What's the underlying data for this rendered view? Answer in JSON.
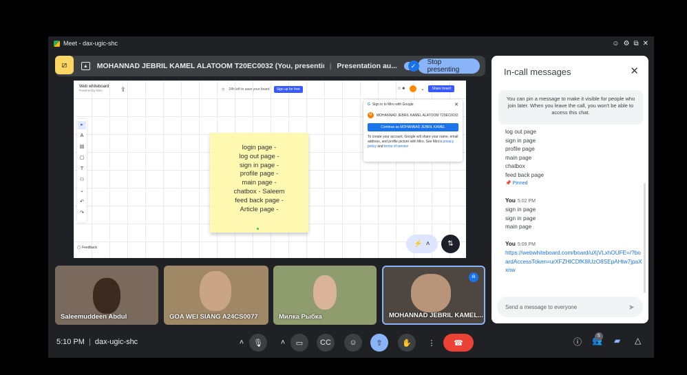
{
  "window": {
    "title": "Meet - dax-ugic-shc",
    "controls": [
      "☺",
      "⚙",
      "⧉",
      "✕"
    ]
  },
  "present_bar": {
    "title": "MOHANNAD JEBRIL KAMEL ALATOOM T20EC0032 (You, presenting, anno...",
    "auto_label": "Presentation au...",
    "stop_label": "Stop presenting"
  },
  "whiteboard": {
    "name": "Web whiteboard",
    "powered_by": "Powered by Miro",
    "save_hint": "24h left to save your board",
    "signup_label": "Sign up for free",
    "share_label": "Share board",
    "feedback_label": "Feedback",
    "tools": [
      "▸",
      "A",
      "▤",
      "▢",
      "T",
      "⚇",
      "⌄",
      "↶",
      "↷"
    ],
    "sticky_lines": [
      "login page -",
      "log out page -",
      "sign in page -",
      "profile page -",
      "main page -",
      "chatbox - Saleem",
      "feed back page -",
      "Article page -"
    ],
    "signin": {
      "header": "Sign in to Miro with Google",
      "account_name": "MOHANNAD JEBRIL KAMEL ALATOOM T20EC0032",
      "account_initial": "M",
      "continue_label": "Continue as MOHANNAD JEBRIL KAMEL",
      "desc_before": "To create your account, Google will share your name, email address, and profile picture with Miro. See Miro's",
      "privacy_link": "privacy policy",
      "desc_and": "and",
      "terms_link": "terms of service"
    }
  },
  "participants": [
    {
      "name": "Saleemuddeen Abdul",
      "bg": "#7a6a5e",
      "face": "#3b2a20"
    },
    {
      "name": "GOA WEI SIANG A24CS0077",
      "bg": "#a08866",
      "face": "#c9a585"
    },
    {
      "name": "Милка Рыбка",
      "bg": "#8f9c6e",
      "face": "#d9b49a"
    },
    {
      "name": "MOHANNAD JEBRIL KAMEL...",
      "bg": "#4e4640",
      "face": "#b89478"
    }
  ],
  "chat": {
    "title": "In-call messages",
    "info": "You can pin a message to make it visible for people who join later. When you leave the call, you won't be able to access this chat.",
    "pinned_lines": [
      "log out page",
      "sign in page",
      "profile page",
      "main page",
      "chatbox",
      "feed back page"
    ],
    "pinned_label": "Pinned",
    "messages": [
      {
        "sender": "You",
        "time": "5:02 PM",
        "lines": [
          "sign in page",
          "sign in page",
          "main page"
        ]
      },
      {
        "sender": "You",
        "time": "5:09 PM",
        "link": "https://webwhiteboard.com/board/uXjVLxhOUFE=/?boardAccessToken=urXFZHICDfK8lUzO8SEpAHtw7jpaXxnw"
      }
    ],
    "input_placeholder": "Send a message to everyone"
  },
  "bottom": {
    "time": "5:10 PM",
    "meeting_code": "dax-ugic-shc",
    "people_count": "5"
  },
  "colors": {
    "accent_blue": "#8ab4f8",
    "end_call_red": "#ea4335",
    "present_yellow": "#fdd663",
    "sticky_yellow": "#fff9b1"
  }
}
